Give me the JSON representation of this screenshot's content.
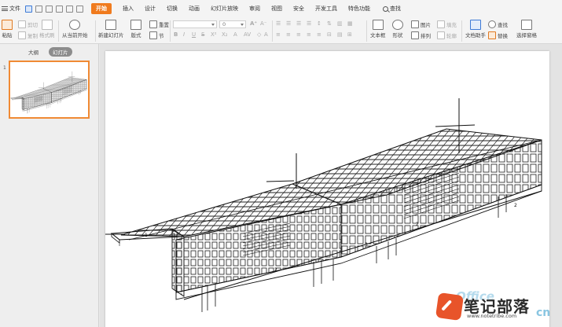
{
  "menubar": {
    "file_label": "文件",
    "items": [
      "开始",
      "插入",
      "设计",
      "切换",
      "动画",
      "幻灯片放映",
      "审阅",
      "视图",
      "安全",
      "开发工具",
      "特色功能"
    ],
    "active_index": 0,
    "search_label": "查找"
  },
  "ribbon": {
    "paste": "粘贴",
    "cut": "剪切",
    "copy": "复制",
    "format_painter": "格式刷",
    "from_current": "从当前开始",
    "new_slide": "新建幻灯片",
    "layout": "版式",
    "reset": "重置",
    "section": "节",
    "font_size_value": "0",
    "text_box": "文本框",
    "shape": "形状",
    "picture": "图片",
    "fill": "填充",
    "arrange": "排列",
    "outline": "轮廓",
    "doc_assistant": "文档助手",
    "find": "查找",
    "replace": "替换",
    "select_pane": "选择窗格"
  },
  "left_pane": {
    "tabs": [
      "大纲",
      "幻灯片"
    ],
    "active_tab": 1,
    "slide_number": "1"
  },
  "slide": {
    "labels": [
      "1",
      "2",
      "3",
      "2",
      "2"
    ]
  },
  "watermark": {
    "ghost": "Office",
    "main": "笔记部落",
    "sub": "www.notetribe.com",
    "tail": "cn"
  },
  "colors": {
    "accent": "#f07b1e",
    "thumb_border": "#f08a34",
    "watermark_badge": "#e8542a"
  }
}
